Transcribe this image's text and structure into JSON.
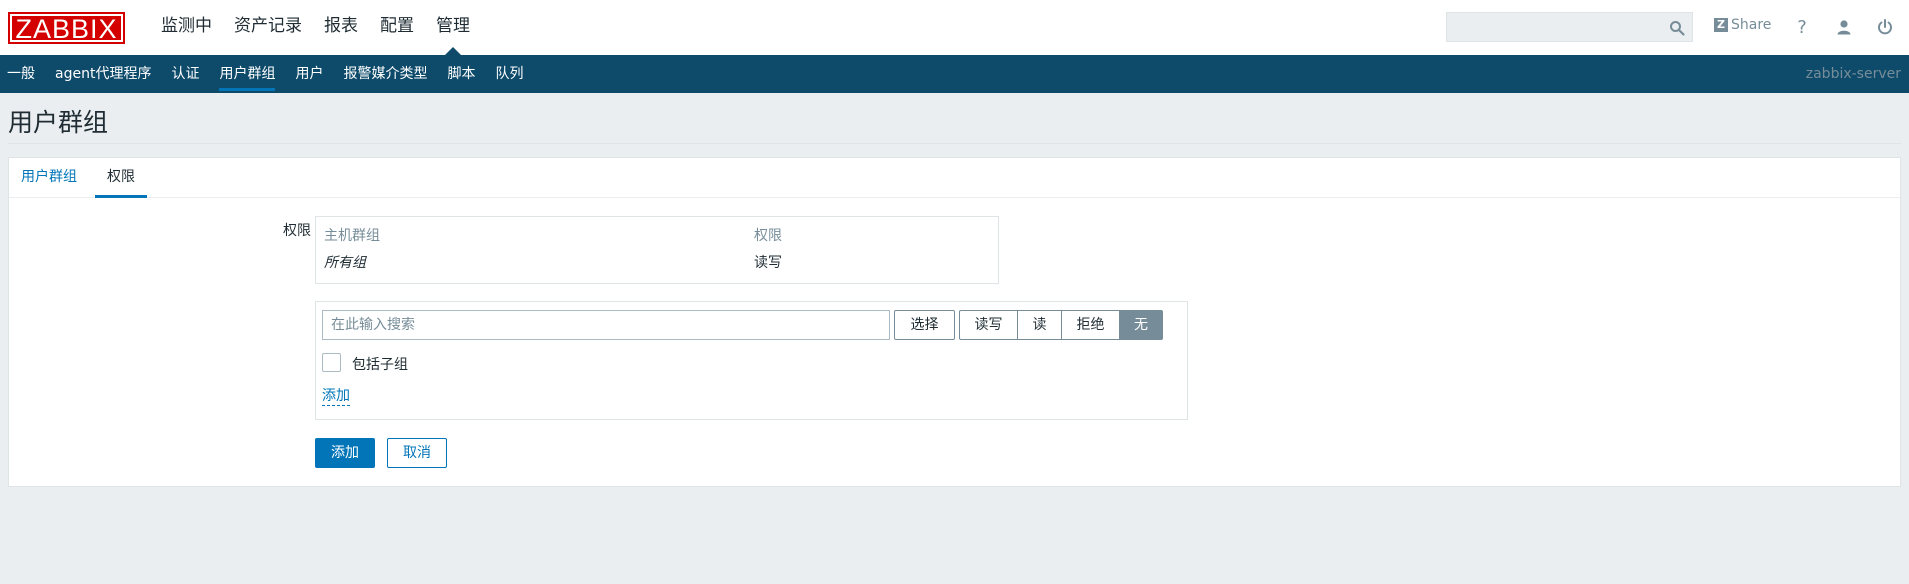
{
  "header": {
    "logo": "ZABBIX",
    "nav": [
      "监测中",
      "资产记录",
      "报表",
      "配置",
      "管理"
    ],
    "active_nav": "管理",
    "search": {
      "value": "",
      "placeholder": ""
    },
    "share_label": "Share",
    "share_badge": "Z",
    "help_label": "?",
    "icons": [
      "search-icon",
      "share-icon",
      "help-icon",
      "profile-icon",
      "sign-out-icon"
    ]
  },
  "subnav": {
    "items": [
      "一般",
      "agent代理程序",
      "认证",
      "用户群组",
      "用户",
      "报警媒介类型",
      "脚本",
      "队列"
    ],
    "active": "用户群组",
    "server": "zabbix-server"
  },
  "page": {
    "title": "用户群组"
  },
  "form": {
    "tabs": [
      "用户群组",
      "权限"
    ],
    "active_tab": "权限",
    "permissions_label": "权限",
    "table": {
      "headers": [
        "主机群组",
        "权限"
      ],
      "rows": [
        {
          "group": "所有组",
          "permission": "读写"
        }
      ]
    },
    "search": {
      "value": "",
      "placeholder": "在此输入搜索"
    },
    "select_button": "选择",
    "permission_options": [
      "读写",
      "读",
      "拒绝",
      "无"
    ],
    "selected_permission": "无",
    "include_subgroups_label": "包括子组",
    "include_subgroups_checked": false,
    "add_link": "添加",
    "submit_button": "添加",
    "cancel_button": "取消"
  },
  "colors": {
    "brand_red": "#d40000",
    "subnav_bg": "#0e4b6b",
    "accent_blue": "#0275b8",
    "muted": "#768d99",
    "page_bg": "#ebeef0"
  }
}
